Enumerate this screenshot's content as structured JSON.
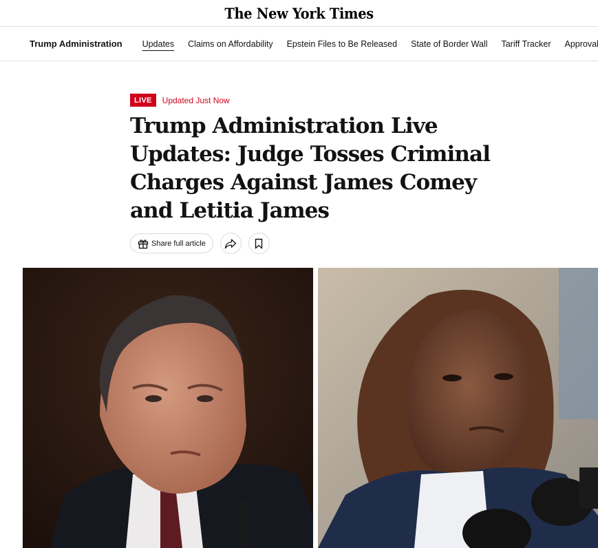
{
  "masthead": {
    "logo": "The New York Times"
  },
  "nav": {
    "section": "Trump Administration",
    "links": [
      "Updates",
      "Claims on Affordability",
      "Epstein Files to Be Released",
      "State of Border Wall",
      "Tariff Tracker",
      "Approval Rating"
    ]
  },
  "article": {
    "live_badge": "LIVE",
    "updated": "Updated Just Now",
    "headline": "Trump Administration Live Updates: Judge Tosses Criminal Charges Against James Comey and Letitia James"
  },
  "actions": {
    "share_full_label": "Share full article"
  },
  "icons": [
    "gift-icon",
    "share-icon",
    "bookmark-icon"
  ],
  "colors": {
    "live_red": "#d0021b",
    "text": "#121212",
    "divider": "#dfdfdf"
  }
}
